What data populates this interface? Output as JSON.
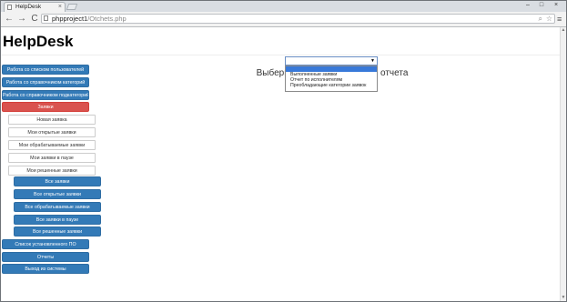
{
  "browser": {
    "tab_title": "HelpDesk",
    "tab_close": "×",
    "window_controls": [
      "–",
      "□",
      "×"
    ],
    "nav": {
      "back": "←",
      "forward": "→",
      "reload": "C"
    },
    "url_host": "phpproject1",
    "url_path": "/Otchets.php",
    "omnibox_icons": [
      "search-icon",
      "star-icon"
    ],
    "menu": "≡"
  },
  "page": {
    "title": "HelpDesk",
    "report_heading": "Выберите вид необходимого отчета",
    "select": {
      "selected": "",
      "arrow": "▼",
      "options": [
        "",
        "Выполненные заявки",
        "Отчет по исполнителям",
        "Преобладающие категории заявок"
      ]
    }
  },
  "sidebar": {
    "users": "Работа со списком пользователей",
    "categories": "Работа со справочником категорий",
    "subcategories": "Работа со справочником подкатегорий",
    "requests": "Заявки",
    "my_requests": [
      "Новая заявка",
      "Мои открытые заявки",
      "Мои обрабатываемые заявки",
      "Мои заявки в паузе",
      "Мои решенные заявки"
    ],
    "all_requests": [
      "Все заявки",
      "Все открытые заявки",
      "Все обрабатываемые заявки",
      "Все заявки в паузе",
      "Все решенные заявки"
    ],
    "software": "Список установленного ПО",
    "reports": "Отчеты",
    "logout": "Выход из системы"
  },
  "colors": {
    "primary": "#337ab7",
    "danger": "#d9534f",
    "selected_option": "#3879d9"
  }
}
